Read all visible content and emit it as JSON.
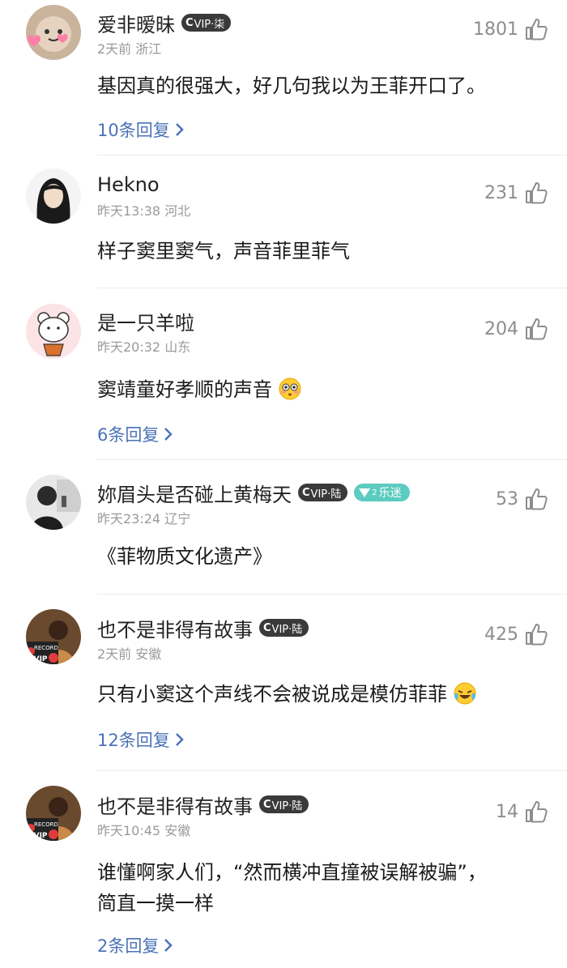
{
  "comments": [
    {
      "username": "爱非暧昧",
      "badge": "VIP·柒",
      "time": "2天前",
      "location": "浙江",
      "likes": "1801",
      "text": "基因真的很强大，好几句我以为王菲开口了。",
      "replies": "10条回复"
    },
    {
      "username": "Hekno",
      "time": "昨天13:38",
      "location": "河北",
      "likes": "231",
      "text": "样子窦里窦气，声音菲里菲气"
    },
    {
      "username": "是一只羊啦",
      "time": "昨天20:32",
      "location": "山东",
      "likes": "204",
      "text": "窦靖童好孝顺的声音",
      "emoji": "flushed-face-emoji",
      "replies": "6条回复"
    },
    {
      "username": "妳眉头是否碰上黄梅天",
      "badge": "VIP·陆",
      "fan_badge": "乐迷",
      "fan_level": "2",
      "time": "昨天23:24",
      "location": "辽宁",
      "likes": "53",
      "text": "《菲物质文化遗产》"
    },
    {
      "username": "也不是非得有故事",
      "badge": "VIP·陆",
      "time": "2天前",
      "location": "安徽",
      "likes": "425",
      "text": "只有小窦这个声线不会被说成是模仿菲菲",
      "emoji": "laughing-tears-emoji",
      "replies": "12条回复"
    },
    {
      "username": "也不是非得有故事",
      "badge": "VIP·陆",
      "time": "昨天10:45",
      "location": "安徽",
      "likes": "14",
      "text_line1": "谁懂啊家人们，“然而横冲直撞被误解被骗”，",
      "text_line2": "简直一摸一样",
      "replies": "2条回复"
    }
  ],
  "avatar_labels": {
    "record": "RECORD"
  }
}
